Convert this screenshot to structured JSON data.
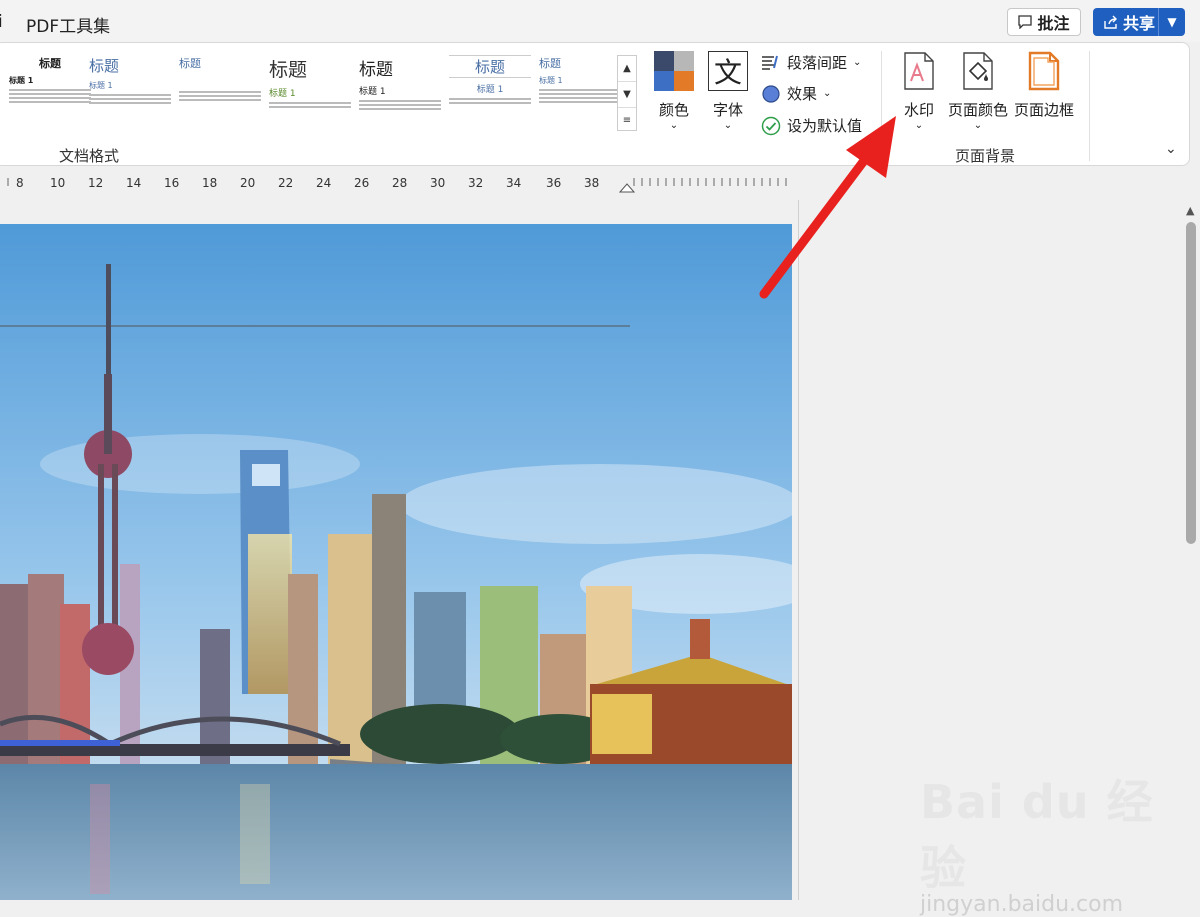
{
  "titlebar": {
    "tab_fragment": "i",
    "pdf_tools": "PDF工具集",
    "comment_label": "批注",
    "share_label": "共享"
  },
  "ribbon": {
    "styles": {
      "group_label": "文档格式",
      "thumbnails": [
        {
          "title": "标题",
          "sub": "标题 1"
        },
        {
          "title": "标题",
          "sub": "标题 1"
        },
        {
          "title": "标题",
          "sub": ""
        },
        {
          "title": "标题",
          "sub": "标题 1"
        },
        {
          "title": "标题",
          "sub": "标题 1"
        },
        {
          "title": "标题",
          "sub": "标题 1"
        },
        {
          "title": "标题",
          "sub": "标题 1"
        }
      ]
    },
    "colors_label": "颜色",
    "fonts_label": "字体",
    "paragraph_spacing_label": "段落间距",
    "effects_label": "效果",
    "set_default_label": "设为默认值",
    "page_background": {
      "group_label": "页面背景",
      "watermark_label": "水印",
      "page_color_label": "页面颜色",
      "page_border_label": "页面边框"
    }
  },
  "ruler": {
    "ticks": [
      "8",
      "10",
      "12",
      "14",
      "16",
      "18",
      "20",
      "22",
      "24",
      "26",
      "28",
      "30",
      "32",
      "34",
      "36",
      "38"
    ]
  },
  "watermark": {
    "line1": "Bai du 经验",
    "line2": "jingyan.baidu.com"
  },
  "colors": {
    "accent_blue": "#1f5fbf",
    "arrow_red": "#e8211e"
  }
}
